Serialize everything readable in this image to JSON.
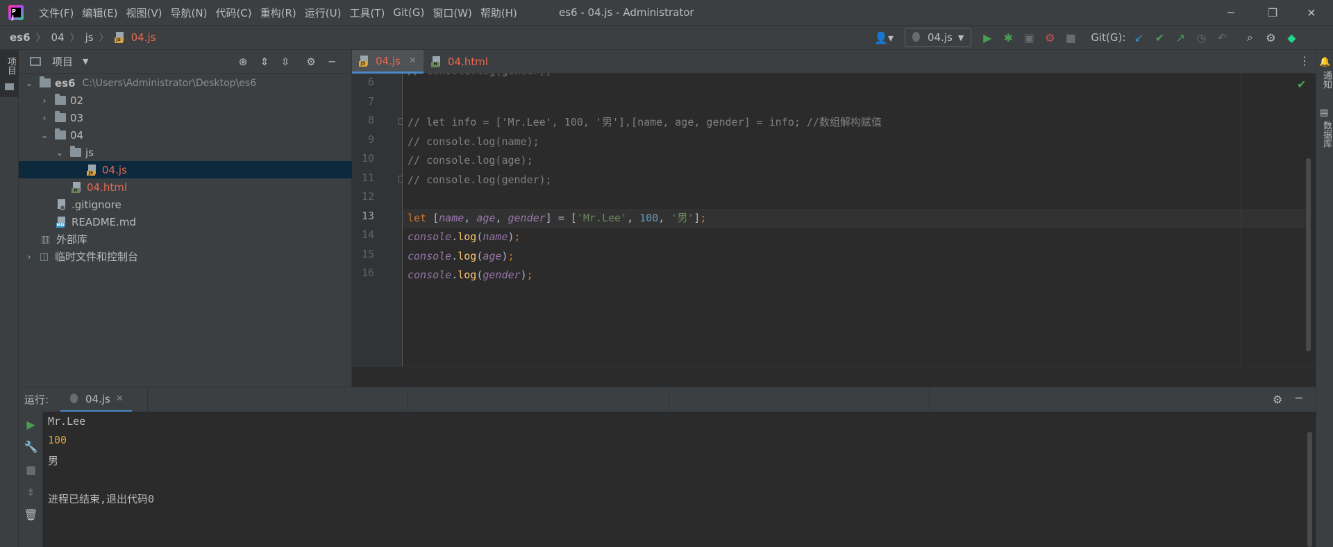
{
  "menu": [
    "文件(F)",
    "编辑(E)",
    "视图(V)",
    "导航(N)",
    "代码(C)",
    "重构(R)",
    "运行(U)",
    "工具(T)",
    "Git(G)",
    "窗口(W)",
    "帮助(H)"
  ],
  "window_title": "es6 - 04.js - Administrator",
  "breadcrumb": [
    "es6",
    "04",
    "js",
    "04.js"
  ],
  "run_config": "04.js",
  "git_label": "Git(G):",
  "left_strip": {
    "project_tab": "项目"
  },
  "right_strip": {
    "notifications": "通知",
    "database": "数据库"
  },
  "project_panel": {
    "title": "项目",
    "tree": [
      {
        "label": "es6",
        "hint": "C:\\Users\\Administrator\\Desktop\\es6",
        "level": 0,
        "expanded": true,
        "type": "folder"
      },
      {
        "label": "02",
        "level": 1,
        "expanded": false,
        "type": "folder"
      },
      {
        "label": "03",
        "level": 1,
        "expanded": false,
        "type": "folder"
      },
      {
        "label": "04",
        "level": 1,
        "expanded": true,
        "type": "folder"
      },
      {
        "label": "js",
        "level": 2,
        "expanded": true,
        "type": "folder"
      },
      {
        "label": "04.js",
        "level": 3,
        "type": "js",
        "selected": true
      },
      {
        "label": "04.html",
        "level": 2,
        "type": "html"
      },
      {
        "label": ".gitignore",
        "level": 1,
        "type": "file"
      },
      {
        "label": "README.md",
        "level": 1,
        "type": "md"
      },
      {
        "label": "外部库",
        "level": 0,
        "type": "lib"
      },
      {
        "label": "临时文件和控制台",
        "level": 0,
        "type": "scratch"
      }
    ]
  },
  "editor": {
    "tabs": [
      {
        "label": "04.js",
        "active": true,
        "type": "js"
      },
      {
        "label": "04.html",
        "active": false,
        "type": "html"
      }
    ],
    "partial_top_line": "// console.log(gender);",
    "lines": [
      {
        "number": "6",
        "text": ""
      },
      {
        "number": "7",
        "text": ""
      },
      {
        "number": "8",
        "text": "// let info = ['Mr.Lee', 100, '男'],[name, age, gender] = info; //数组解构赋值"
      },
      {
        "number": "9",
        "text": "// console.log(name);"
      },
      {
        "number": "10",
        "text": "// console.log(age);"
      },
      {
        "number": "11",
        "text": "// console.log(gender);"
      },
      {
        "number": "12",
        "text": ""
      },
      {
        "number": "13",
        "text": "let [name, age, gender] = ['Mr.Lee', 100, '男'];"
      },
      {
        "number": "14",
        "text": "console.log(name);"
      },
      {
        "number": "15",
        "text": "console.log(age);"
      },
      {
        "number": "16",
        "text": "console.log(gender);"
      }
    ],
    "current_line": "13"
  },
  "run_panel": {
    "label": "运行:",
    "tab": "04.js",
    "output": [
      "Mr.Lee",
      "100",
      "男",
      "",
      "进程已结束,退出代码0"
    ]
  },
  "colors": {
    "background": "#2b2b2b",
    "panel": "#3c3f41",
    "selection": "#0d293e",
    "accent": "#4a88c7",
    "modified_file": "#e8694f"
  }
}
